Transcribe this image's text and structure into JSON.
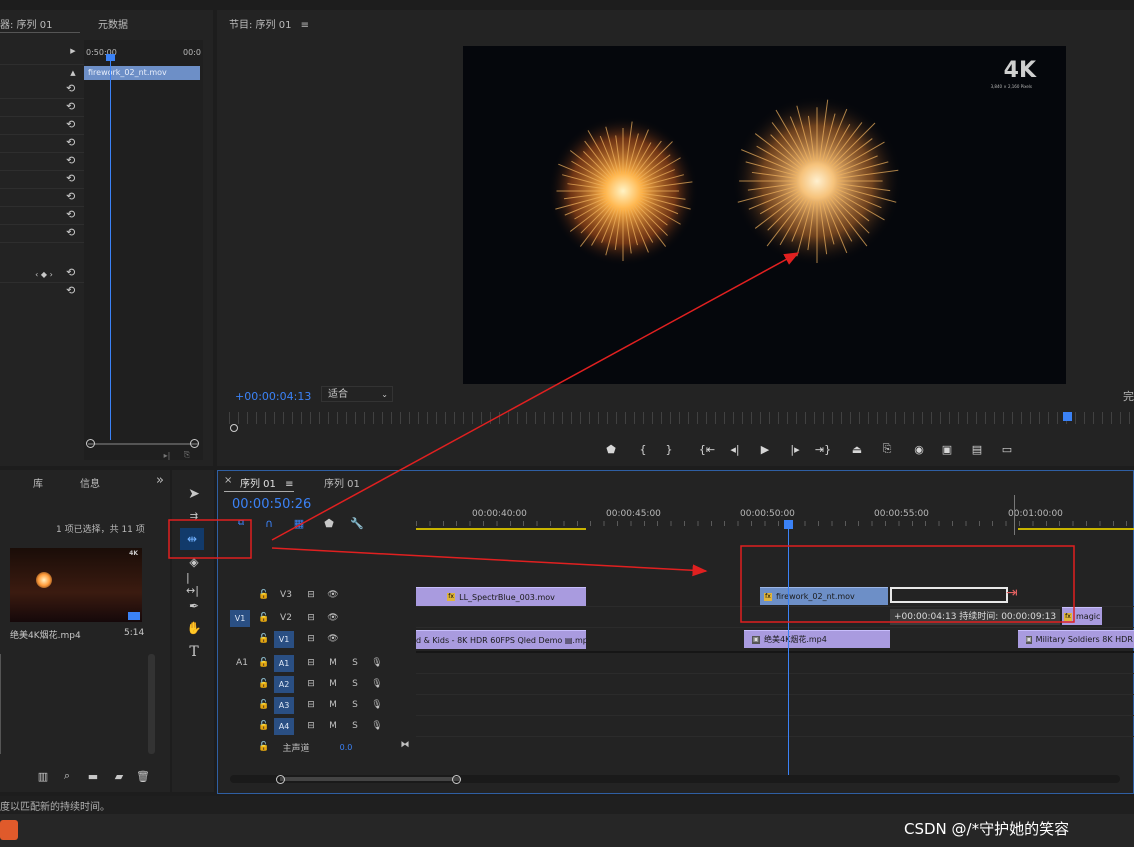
{
  "effect_controls": {
    "tab_label": "器: 序列 01",
    "metadata_tab": "元数据",
    "mini_time_start": "0:50:00",
    "mini_time_end": "00:0",
    "clip_label": "firework_02_nt.mov"
  },
  "program_monitor": {
    "title": "节目: 序列 01",
    "menu_icon": "≡",
    "timecode": "+00:00:04:13",
    "fit_label": "适合",
    "complete_label": "完",
    "badge_4k": "4K",
    "badge_sub": "3,840 × 2,160 Pixels"
  },
  "project_panel": {
    "tab_library": "库",
    "tab_info": "信息",
    "overflow": "»",
    "selection_info": "1 项已选择，共 11 项",
    "thumb_badge": "4K",
    "item_name": "绝美4K烟花.mp4",
    "item_duration": "5:14"
  },
  "timeline": {
    "close": "×",
    "seq_tab": "序列 01",
    "seq_tab2": "序列 01",
    "menu_icon": "≡",
    "timecode": "00:00:50:26",
    "ruler_labels": [
      "00:00:40:00",
      "00:00:45:00",
      "00:00:50:00",
      "00:00:55:00",
      "00:01:00:00"
    ],
    "video_tracks": [
      {
        "name": "V3",
        "source": ""
      },
      {
        "name": "V2",
        "source": "V1"
      },
      {
        "name": "V1",
        "source": ""
      }
    ],
    "audio_tracks": [
      {
        "name": "A1",
        "source": "A1"
      },
      {
        "name": "A2",
        "source": ""
      },
      {
        "name": "A3",
        "source": ""
      },
      {
        "name": "A4",
        "source": ""
      }
    ],
    "master_label": "主声道",
    "master_value": "0.0",
    "mute_label": "M",
    "solo_label": "S",
    "clips": {
      "v3_a": "LL_SpectrBlue_003.mov",
      "v3_b": "firework_02_nt.mov",
      "v2_tooltip": "+00:00:04:13  持续时间: 00:00:09:13",
      "v2_magic": "magic",
      "v1_a": "d & Kids - 8K HDR 60FPS Qled Demo ▤.mp4",
      "v1_b": "绝美4K烟花.mp4",
      "v1_c": "Military Soldiers 8K HDR O"
    }
  },
  "status_bar": {
    "hint": "度以匹配新的持续时间。",
    "watermark": "CSDN @/*守护她的笑容"
  },
  "tools": [
    "selection-tool",
    "track-select-tool",
    "ripple-edit-tool",
    "razor-tool",
    "slip-tool",
    "pen-tool",
    "hand-tool",
    "type-tool"
  ],
  "colors": {
    "accent_blue": "#3b82f6",
    "clip_purple": "#a99bdf",
    "clip_blue": "#6d8fc7",
    "annotation_red": "#e02020",
    "work_area_yellow": "#c8b400"
  }
}
